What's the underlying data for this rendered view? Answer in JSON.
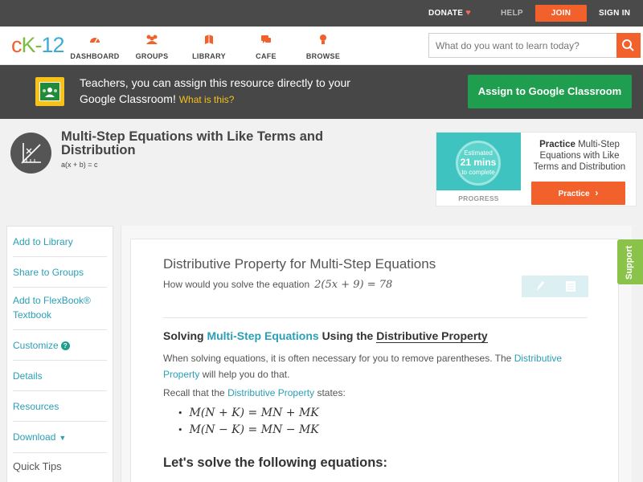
{
  "topbar": {
    "donate": "DONATE",
    "help": "HELP",
    "join": "JOIN",
    "signin": "SIGN IN"
  },
  "nav": {
    "logo_c": "c",
    "logo_k": "K",
    "logo_dash": "-",
    "logo_num": "12",
    "items": [
      {
        "label": "DASHBOARD",
        "icon": "dashboard-icon"
      },
      {
        "label": "GROUPS",
        "icon": "groups-icon"
      },
      {
        "label": "LIBRARY",
        "icon": "library-icon"
      },
      {
        "label": "CAFE",
        "icon": "cafe-icon"
      },
      {
        "label": "BROWSE",
        "icon": "browse-icon"
      }
    ],
    "search_placeholder": "What do you want to learn today?"
  },
  "banner": {
    "text": "Teachers, you can assign this resource directly to your Google Classroom!",
    "what_is": "What is this?",
    "button": "Assign to Google Classroom"
  },
  "concept": {
    "title": "Multi-Step Equations with Like Terms and Distribution",
    "subtitle": "a(x + b) = c",
    "practice": {
      "est_line1": "Estimated",
      "est_line2": "21 mins",
      "est_line3": "to complete",
      "progress": "PROGRESS",
      "text_bold": "Practice",
      "text_rest": "Multi-Step Equations with Like Terms and Distribution",
      "button": "Practice"
    }
  },
  "sidebar": {
    "items": [
      "Add to Library",
      "Share to Groups",
      "Add to FlexBook® Textbook",
      "Customize",
      "Details",
      "Resources",
      "Download"
    ],
    "quick_tips": "Quick Tips"
  },
  "content": {
    "section_title": "Distributive Property for Multi-Step Equations",
    "question": "How would you solve the equation",
    "question_eq": "2(5x + 9) = 78",
    "h3_pre": "Solving",
    "h3_link1": "Multi-Step Equations",
    "h3_mid": "Using the",
    "h3_link2": "Distributive Property",
    "p1_pre": "When solving equations, it is often necessary for you to remove parentheses. The",
    "p1_link": "Distributive Property",
    "p1_post": "will help you do that.",
    "p2_pre": "Recall that the",
    "p2_link": "Distributive Property",
    "p2_post": "states:",
    "eq1": "M(N + K) = MN + MK",
    "eq2": "M(N − K) = MN − MK",
    "h2": "Let's solve the following equations:"
  },
  "support": "Support",
  "colors": {
    "accent_orange": "#f2602c",
    "accent_teal": "#2b9fb5",
    "google_green": "#1e9e4e",
    "support_green": "#8bc34a"
  }
}
